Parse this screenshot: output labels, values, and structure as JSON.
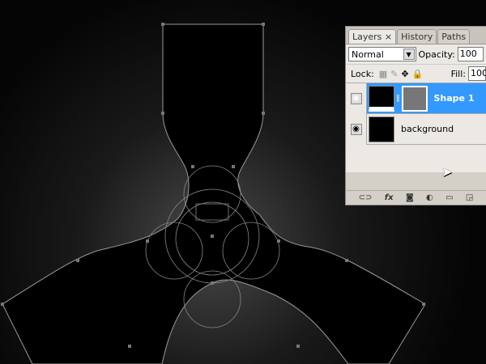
{
  "panel": {
    "tabs": [
      {
        "label": "Layers ×"
      },
      {
        "label": "History"
      },
      {
        "label": "Paths"
      }
    ],
    "blend_mode": "Normal",
    "opacity_label": "Opacity:",
    "opacity_value": "100",
    "lock_label": "Lock:",
    "fill_label": "Fill:",
    "fill_value": "100",
    "layers": [
      {
        "name": "Shape 1",
        "selected": true
      },
      {
        "name": "background",
        "selected": false
      }
    ],
    "bottom_icons": [
      "link-icon",
      "fx-icon",
      "mask-icon",
      "adjustment-icon",
      "folder-icon",
      "new-layer-icon"
    ]
  },
  "colors": {
    "selection": "#3399ff",
    "path": "#9a9a9a"
  }
}
